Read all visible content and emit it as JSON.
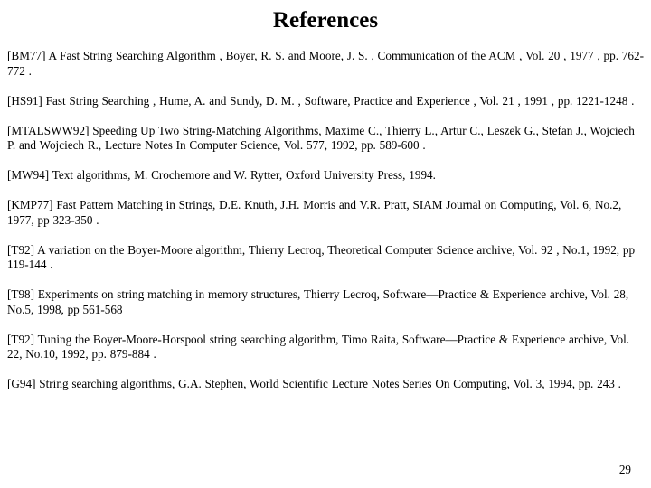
{
  "slide": {
    "title": "References",
    "page_number": "29",
    "text_color": "#000000",
    "background_color": "#ffffff",
    "references": [
      {
        "key": "BM77",
        "text": "[BM77]    A Fast String Searching Algorithm , Boyer, R. S. and Moore, J. S. , Communication of the ACM , Vol. 20 , 1977 , pp. 762-772 ."
      },
      {
        "key": "HS91",
        "text": "[HS91]    Fast String Searching , Hume, A. and Sundy, D. M. , Software, Practice and Experience , Vol. 21 , 1991 , pp. 1221-1248 ."
      },
      {
        "key": "MTALSWW92",
        "text": "[MTALSWW92]  Speeding Up Two String-Matching Algorithms,  Maxime C., Thierry L., Artur C., Leszek G., Stefan J., Wojciech P. and Wojciech R.,  Lecture Notes In Computer Science,  Vol. 577,  1992,  pp. 589-600 ."
      },
      {
        "key": "MW94",
        "text": "[MW94]  Text algorithms,  M. Crochemore and W. Rytter,  Oxford University Press,  1994."
      },
      {
        "key": "KMP77",
        "text": "[KMP77]  Fast Pattern Matching in Strings,  D.E. Knuth, J.H. Morris and V.R. Pratt,  SIAM Journal on Computing, Vol. 6,  No.2,  1977,  pp 323-350 ."
      },
      {
        "key": "T92-variation",
        "text": "[T92]  A variation on the Boyer-Moore algorithm,  Thierry Lecroq,  Theoretical Computer Science archive,  Vol. 92 , No.1,  1992,  pp 119-144  ."
      },
      {
        "key": "T98",
        "text": "[T98]  Experiments on string matching in memory structures,  Thierry Lecroq,  Software—Practice & Experience archive,  Vol. 28,  No.5,  1998,  pp 561-568"
      },
      {
        "key": "T92-tuning",
        "text": "[T92]  Tuning the Boyer-Moore-Horspool string searching algorithm,  Timo Raita,  Software—Practice & Experience archive,  Vol. 22,  No.10,  1992,  pp. 879-884 ."
      },
      {
        "key": "G94",
        "text": "[G94]  String searching algorithms,  G.A. Stephen,  World Scientific Lecture Notes Series On Computing,  Vol. 3, 1994,  pp. 243  ."
      }
    ]
  }
}
